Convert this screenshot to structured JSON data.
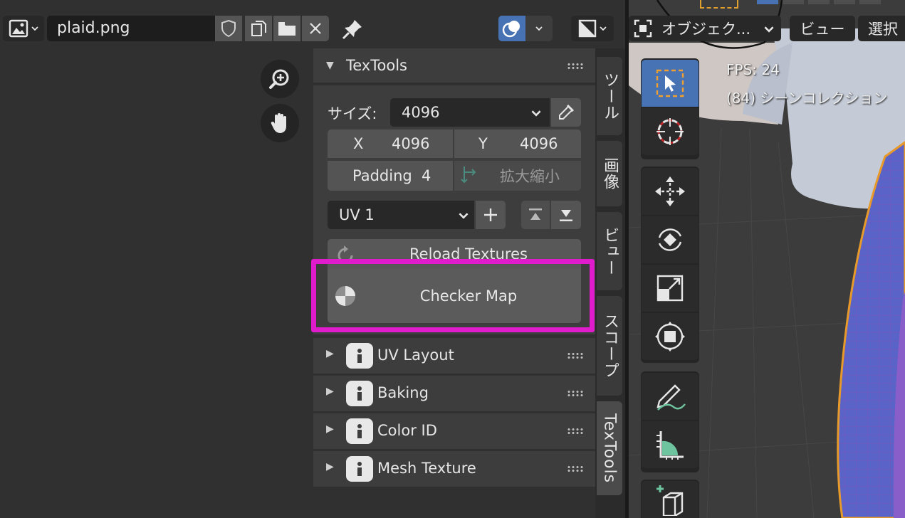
{
  "image_editor": {
    "image_name": "plaid.png"
  },
  "sidebar": {
    "textools_panel": {
      "title": "TexTools",
      "size_label": "サイズ:",
      "size_value": "4096",
      "x_label": "X",
      "x_value": "4096",
      "y_label": "Y",
      "y_value": "4096",
      "padding_label": "Padding",
      "padding_value": "4",
      "scale_label": "拡大縮小",
      "uv_select": "UV 1",
      "reload_label": "Reload Textures",
      "checker_label": "Checker Map"
    },
    "subpanels": [
      {
        "label": "UV Layout"
      },
      {
        "label": "Baking"
      },
      {
        "label": "Color ID"
      },
      {
        "label": "Mesh Texture"
      }
    ]
  },
  "tabs": [
    {
      "label": "ツール"
    },
    {
      "label": "画像"
    },
    {
      "label": "ビュー"
    },
    {
      "label": "スコープ"
    },
    {
      "label": "TexTools"
    }
  ],
  "viewport": {
    "mode_select": "オブジェク...",
    "view_menu": "ビュー",
    "select_menu": "選択",
    "fps_text": "FPS: 24",
    "scene_text": "(84) シーンコレクション"
  },
  "colors": {
    "accent_blue": "#4772b3",
    "highlight": "#e01bcc",
    "panel_bg": "#3d3d3d",
    "header_bg": "#303030"
  }
}
